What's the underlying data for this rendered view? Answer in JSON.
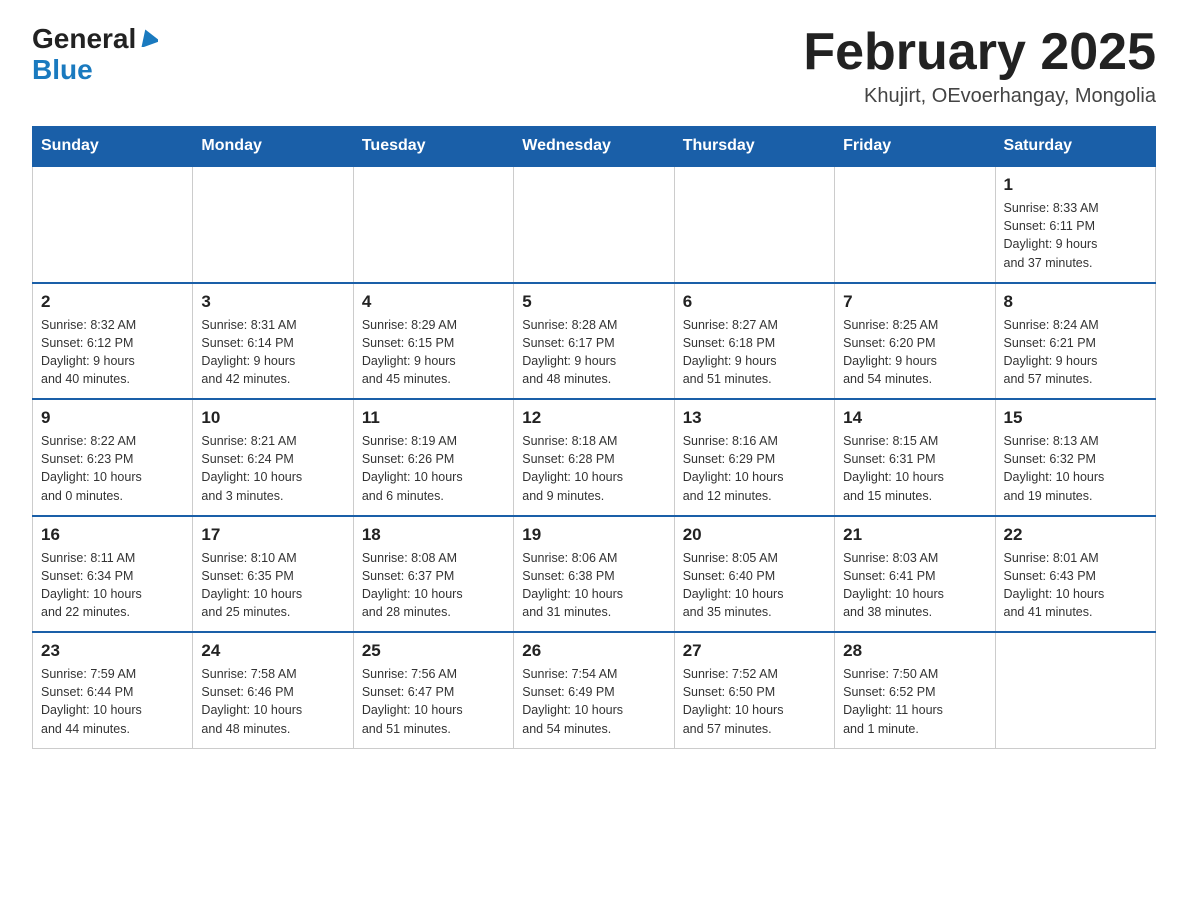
{
  "header": {
    "logo_general": "General",
    "logo_blue": "Blue",
    "title": "February 2025",
    "subtitle": "Khujirt, OEvoerhangay, Mongolia"
  },
  "weekdays": [
    "Sunday",
    "Monday",
    "Tuesday",
    "Wednesday",
    "Thursday",
    "Friday",
    "Saturday"
  ],
  "weeks": [
    [
      {
        "day": "",
        "info": ""
      },
      {
        "day": "",
        "info": ""
      },
      {
        "day": "",
        "info": ""
      },
      {
        "day": "",
        "info": ""
      },
      {
        "day": "",
        "info": ""
      },
      {
        "day": "",
        "info": ""
      },
      {
        "day": "1",
        "info": "Sunrise: 8:33 AM\nSunset: 6:11 PM\nDaylight: 9 hours\nand 37 minutes."
      }
    ],
    [
      {
        "day": "2",
        "info": "Sunrise: 8:32 AM\nSunset: 6:12 PM\nDaylight: 9 hours\nand 40 minutes."
      },
      {
        "day": "3",
        "info": "Sunrise: 8:31 AM\nSunset: 6:14 PM\nDaylight: 9 hours\nand 42 minutes."
      },
      {
        "day": "4",
        "info": "Sunrise: 8:29 AM\nSunset: 6:15 PM\nDaylight: 9 hours\nand 45 minutes."
      },
      {
        "day": "5",
        "info": "Sunrise: 8:28 AM\nSunset: 6:17 PM\nDaylight: 9 hours\nand 48 minutes."
      },
      {
        "day": "6",
        "info": "Sunrise: 8:27 AM\nSunset: 6:18 PM\nDaylight: 9 hours\nand 51 minutes."
      },
      {
        "day": "7",
        "info": "Sunrise: 8:25 AM\nSunset: 6:20 PM\nDaylight: 9 hours\nand 54 minutes."
      },
      {
        "day": "8",
        "info": "Sunrise: 8:24 AM\nSunset: 6:21 PM\nDaylight: 9 hours\nand 57 minutes."
      }
    ],
    [
      {
        "day": "9",
        "info": "Sunrise: 8:22 AM\nSunset: 6:23 PM\nDaylight: 10 hours\nand 0 minutes."
      },
      {
        "day": "10",
        "info": "Sunrise: 8:21 AM\nSunset: 6:24 PM\nDaylight: 10 hours\nand 3 minutes."
      },
      {
        "day": "11",
        "info": "Sunrise: 8:19 AM\nSunset: 6:26 PM\nDaylight: 10 hours\nand 6 minutes."
      },
      {
        "day": "12",
        "info": "Sunrise: 8:18 AM\nSunset: 6:28 PM\nDaylight: 10 hours\nand 9 minutes."
      },
      {
        "day": "13",
        "info": "Sunrise: 8:16 AM\nSunset: 6:29 PM\nDaylight: 10 hours\nand 12 minutes."
      },
      {
        "day": "14",
        "info": "Sunrise: 8:15 AM\nSunset: 6:31 PM\nDaylight: 10 hours\nand 15 minutes."
      },
      {
        "day": "15",
        "info": "Sunrise: 8:13 AM\nSunset: 6:32 PM\nDaylight: 10 hours\nand 19 minutes."
      }
    ],
    [
      {
        "day": "16",
        "info": "Sunrise: 8:11 AM\nSunset: 6:34 PM\nDaylight: 10 hours\nand 22 minutes."
      },
      {
        "day": "17",
        "info": "Sunrise: 8:10 AM\nSunset: 6:35 PM\nDaylight: 10 hours\nand 25 minutes."
      },
      {
        "day": "18",
        "info": "Sunrise: 8:08 AM\nSunset: 6:37 PM\nDaylight: 10 hours\nand 28 minutes."
      },
      {
        "day": "19",
        "info": "Sunrise: 8:06 AM\nSunset: 6:38 PM\nDaylight: 10 hours\nand 31 minutes."
      },
      {
        "day": "20",
        "info": "Sunrise: 8:05 AM\nSunset: 6:40 PM\nDaylight: 10 hours\nand 35 minutes."
      },
      {
        "day": "21",
        "info": "Sunrise: 8:03 AM\nSunset: 6:41 PM\nDaylight: 10 hours\nand 38 minutes."
      },
      {
        "day": "22",
        "info": "Sunrise: 8:01 AM\nSunset: 6:43 PM\nDaylight: 10 hours\nand 41 minutes."
      }
    ],
    [
      {
        "day": "23",
        "info": "Sunrise: 7:59 AM\nSunset: 6:44 PM\nDaylight: 10 hours\nand 44 minutes."
      },
      {
        "day": "24",
        "info": "Sunrise: 7:58 AM\nSunset: 6:46 PM\nDaylight: 10 hours\nand 48 minutes."
      },
      {
        "day": "25",
        "info": "Sunrise: 7:56 AM\nSunset: 6:47 PM\nDaylight: 10 hours\nand 51 minutes."
      },
      {
        "day": "26",
        "info": "Sunrise: 7:54 AM\nSunset: 6:49 PM\nDaylight: 10 hours\nand 54 minutes."
      },
      {
        "day": "27",
        "info": "Sunrise: 7:52 AM\nSunset: 6:50 PM\nDaylight: 10 hours\nand 57 minutes."
      },
      {
        "day": "28",
        "info": "Sunrise: 7:50 AM\nSunset: 6:52 PM\nDaylight: 11 hours\nand 1 minute."
      },
      {
        "day": "",
        "info": ""
      }
    ]
  ]
}
